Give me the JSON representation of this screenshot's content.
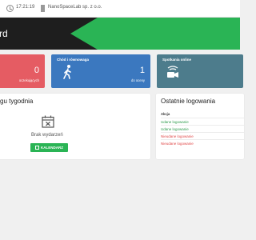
{
  "topbar": {
    "time": "17:21:19",
    "org": "NanoSpaceLab sp. z o.o."
  },
  "hero": {
    "title": "rd"
  },
  "stats": {
    "red": {
      "value": "0",
      "sub": "oczekujących"
    },
    "blue": {
      "label": "Chód i równowaga",
      "value": "1",
      "sub": "do oceny"
    },
    "teal": {
      "label": "Spotkania online"
    }
  },
  "week_card": {
    "title": "gu tygodnia",
    "empty_text": "Brak wydarzeń",
    "button_label": "KALENDARZ"
  },
  "logins_card": {
    "title": "Ostatnie logowania",
    "column_header": "Akcja",
    "rows": [
      {
        "action": "Udane logowanie",
        "status": "ok"
      },
      {
        "action": "Udane logowanie",
        "status": "ok"
      },
      {
        "action": "Nieudane logowanie",
        "status": "fail"
      },
      {
        "action": "Nieudane logowanie",
        "status": "fail"
      }
    ]
  },
  "colors": {
    "green": "#2ab455",
    "dark": "#1e1e1e",
    "red": "#e55c63",
    "blue": "#3b78bf",
    "teal": "#4d7c8c",
    "fail": "#e04848"
  }
}
